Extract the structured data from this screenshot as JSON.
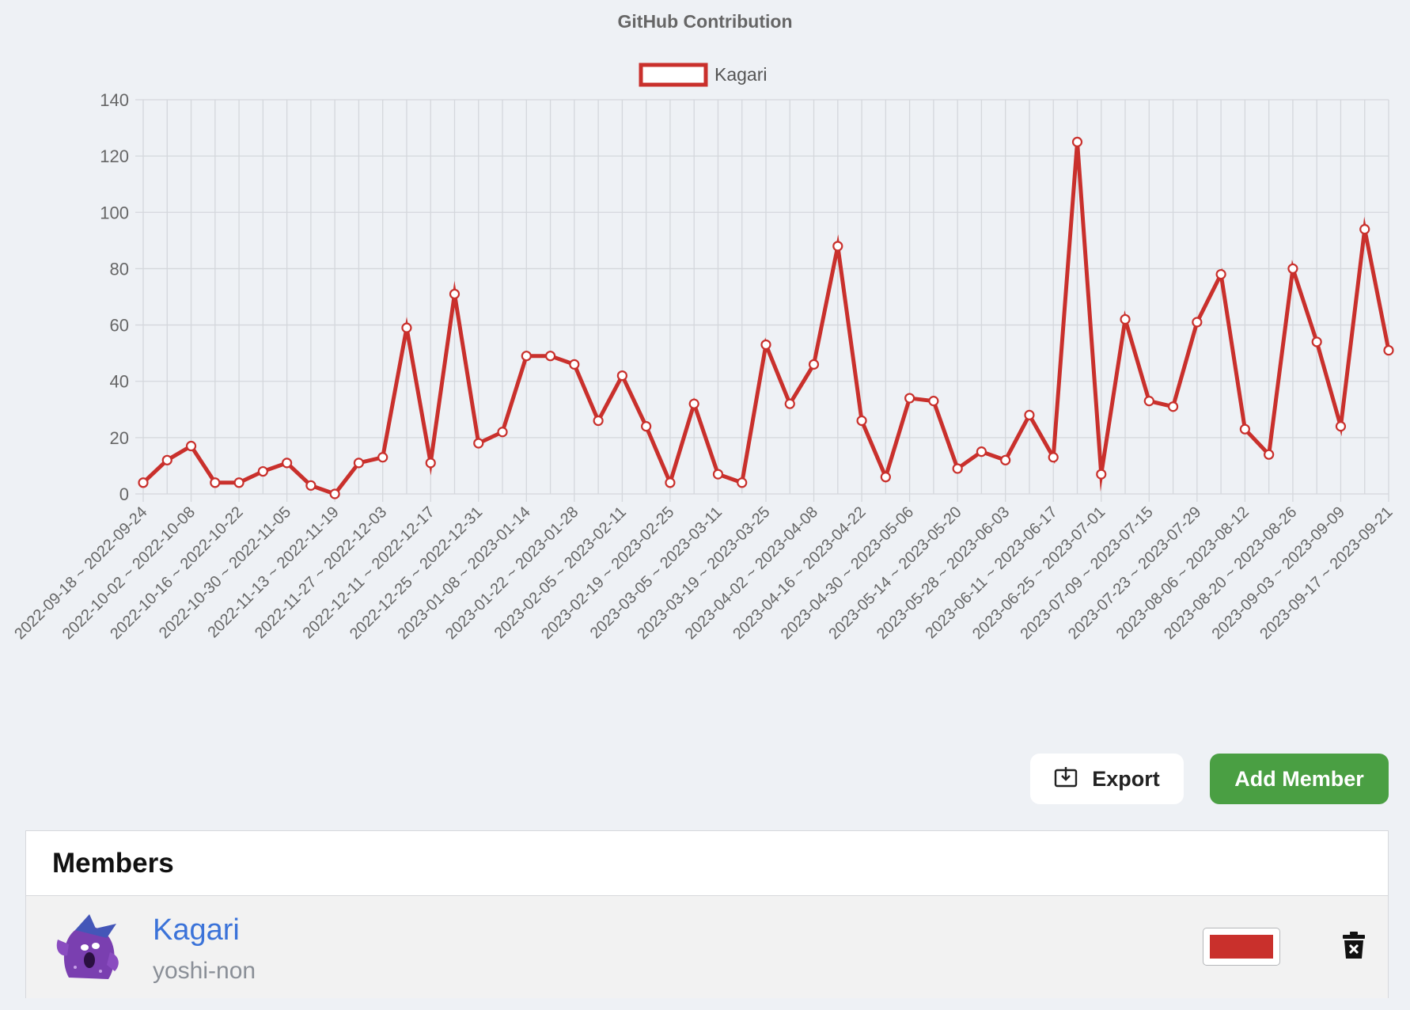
{
  "chart_data": {
    "type": "line",
    "title": "GitHub Contribution",
    "legend_position": "top-center",
    "grid": true,
    "ylim": [
      0,
      140
    ],
    "y_ticks": [
      0,
      20,
      40,
      60,
      80,
      100,
      120,
      140
    ],
    "x_tick_labels": [
      "2022-09-18 ~ 2022-09-24",
      "2022-10-02 ~ 2022-10-08",
      "2022-10-16 ~ 2022-10-22",
      "2022-10-30 ~ 2022-11-05",
      "2022-11-13 ~ 2022-11-19",
      "2022-11-27 ~ 2022-12-03",
      "2022-12-11 ~ 2022-12-17",
      "2022-12-25 ~ 2022-12-31",
      "2023-01-08 ~ 2023-01-14",
      "2023-01-22 ~ 2023-01-28",
      "2023-02-05 ~ 2023-02-11",
      "2023-02-19 ~ 2023-02-25",
      "2023-03-05 ~ 2023-03-11",
      "2023-03-19 ~ 2023-03-25",
      "2023-04-02 ~ 2023-04-08",
      "2023-04-16 ~ 2023-04-22",
      "2023-04-30 ~ 2023-05-06",
      "2023-05-14 ~ 2023-05-20",
      "2023-05-28 ~ 2023-06-03",
      "2023-06-11 ~ 2023-06-17",
      "2023-06-25 ~ 2023-07-01",
      "2023-07-09 ~ 2023-07-15",
      "2023-07-23 ~ 2023-07-29",
      "2023-08-06 ~ 2023-08-12",
      "2023-08-20 ~ 2023-08-26",
      "2023-09-03 ~ 2023-09-09",
      "2023-09-17 ~ 2023-09-21"
    ],
    "series": [
      {
        "name": "Kagari",
        "color": "#c9302c",
        "values": [
          4,
          12,
          17,
          4,
          4,
          8,
          11,
          3,
          0,
          11,
          13,
          59,
          11,
          71,
          18,
          22,
          49,
          49,
          46,
          26,
          42,
          24,
          4,
          32,
          7,
          4,
          53,
          32,
          46,
          88,
          26,
          6,
          34,
          33,
          9,
          15,
          12,
          28,
          13,
          125,
          7,
          62,
          33,
          31,
          61,
          78,
          23,
          14,
          80,
          54,
          24,
          94,
          51
        ]
      }
    ]
  },
  "toolbar": {
    "export_label": "Export",
    "add_member_label": "Add Member"
  },
  "members": {
    "heading": "Members",
    "items": [
      {
        "name": "Kagari",
        "username": "yoshi-non",
        "color": "#c9302c"
      }
    ]
  }
}
